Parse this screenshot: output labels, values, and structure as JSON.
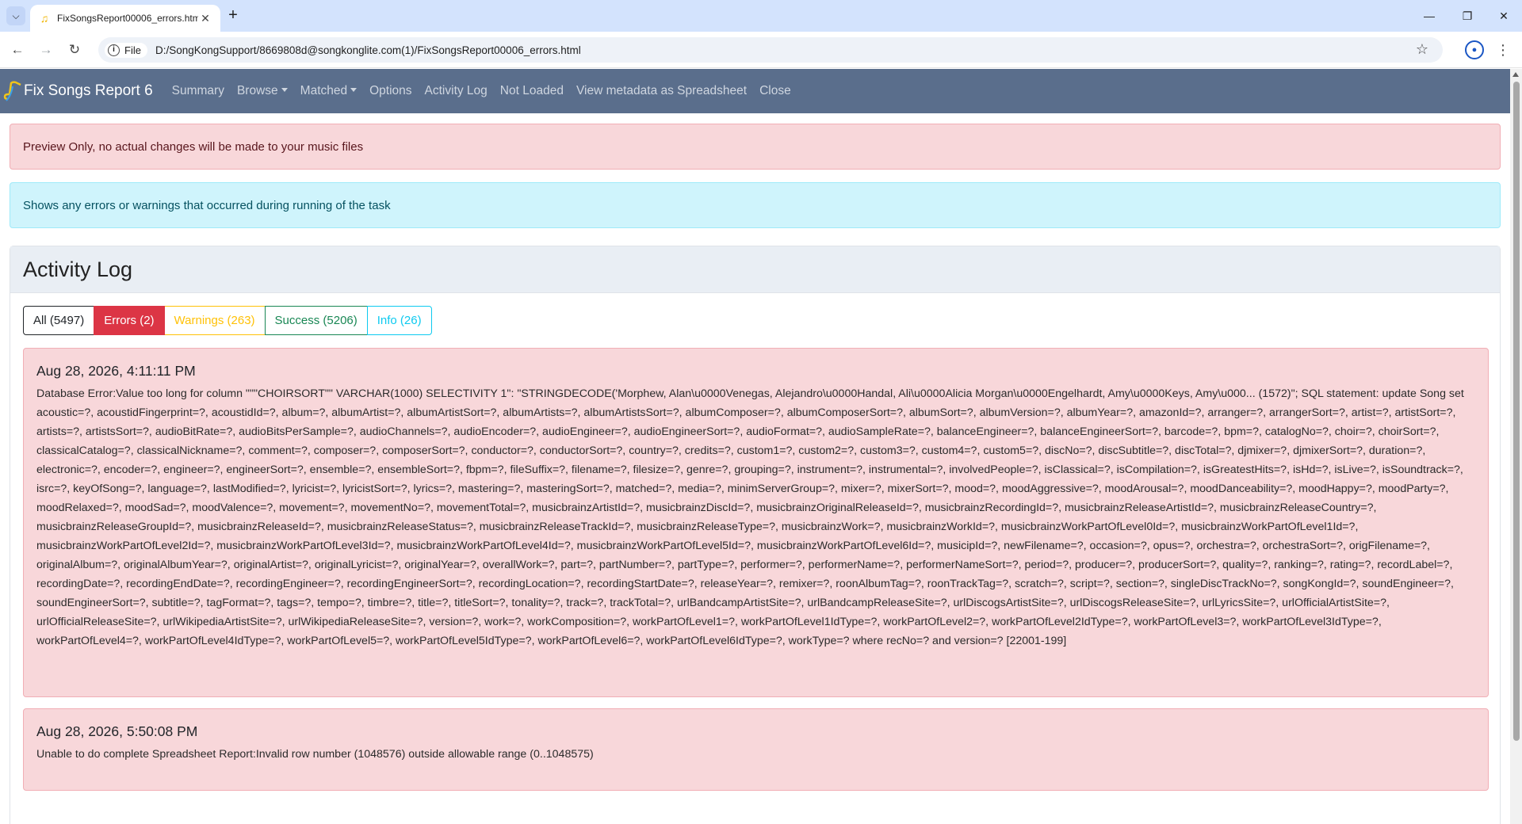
{
  "browser": {
    "tab_title": "FixSongsReport00006_errors.html",
    "file_chip": "File",
    "url": "D:/SongKongSupport/8669808d@songkonglite.com(1)/FixSongsReport00006_errors.html"
  },
  "navbar": {
    "brand": "Fix Songs Report 6",
    "links": [
      "Summary",
      "Browse",
      "Matched",
      "Options",
      "Activity Log",
      "Not Loaded",
      "View metadata as Spreadsheet",
      "Close"
    ]
  },
  "alerts": {
    "preview": "Preview Only, no actual changes will be made to your music files",
    "info": "Shows any errors or warnings that occurred during running of the task"
  },
  "activity": {
    "title": "Activity Log",
    "filters": [
      "All (5497)",
      "Errors (2)",
      "Warnings (263)",
      "Success (5206)",
      "Info (26)"
    ],
    "selected_filter": "Errors (2)",
    "entries": [
      {
        "timestamp": "Aug 28, 2026, 4:11:11 PM",
        "message": "Database Error:Value too long for column \"\"\"CHOIRSORT\"\" VARCHAR(1000) SELECTIVITY 1\": \"STRINGDECODE('Morphew, Alan\\u0000Venegas, Alejandro\\u0000Handal, Ali\\u0000Alicia Morgan\\u0000Engelhardt, Amy\\u0000Keys, Amy\\u000... (1572)\"; SQL statement: update Song set acoustic=?, acoustidFingerprint=?, acoustidId=?, album=?, albumArtist=?, albumArtistSort=?, albumArtists=?, albumArtistsSort=?, albumComposer=?, albumComposerSort=?, albumSort=?, albumVersion=?, albumYear=?, amazonId=?, arranger=?, arrangerSort=?, artist=?, artistSort=?, artists=?, artistsSort=?, audioBitRate=?, audioBitsPerSample=?, audioChannels=?, audioEncoder=?, audioEngineer=?, audioEngineerSort=?, audioFormat=?, audioSampleRate=?, balanceEngineer=?, balanceEngineerSort=?, barcode=?, bpm=?, catalogNo=?, choir=?, choirSort=?, classicalCatalog=?, classicalNickname=?, comment=?, composer=?, composerSort=?, conductor=?, conductorSort=?, country=?, credits=?, custom1=?, custom2=?, custom3=?, custom4=?, custom5=?, discNo=?, discSubtitle=?, discTotal=?, djmixer=?, djmixerSort=?, duration=?, electronic=?, encoder=?, engineer=?, engineerSort=?, ensemble=?, ensembleSort=?, fbpm=?, fileSuffix=?, filename=?, filesize=?, genre=?, grouping=?, instrument=?, instrumental=?, involvedPeople=?, isClassical=?, isCompilation=?, isGreatestHits=?, isHd=?, isLive=?, isSoundtrack=?, isrc=?, keyOfSong=?, language=?, lastModified=?, lyricist=?, lyricistSort=?, lyrics=?, mastering=?, masteringSort=?, matched=?, media=?, minimServerGroup=?, mixer=?, mixerSort=?, mood=?, moodAggressive=?, moodArousal=?, moodDanceability=?, moodHappy=?, moodParty=?, moodRelaxed=?, moodSad=?, moodValence=?, movement=?, movementNo=?, movementTotal=?, musicbrainzArtistId=?, musicbrainzDiscId=?, musicbrainzOriginalReleaseId=?, musicbrainzRecordingId=?, musicbrainzReleaseArtistId=?, musicbrainzReleaseCountry=?, musicbrainzReleaseGroupId=?, musicbrainzReleaseId=?, musicbrainzReleaseStatus=?, musicbrainzReleaseTrackId=?, musicbrainzReleaseType=?, musicbrainzWork=?, musicbrainzWorkId=?, musicbrainzWorkPartOfLevel0Id=?, musicbrainzWorkPartOfLevel1Id=?, musicbrainzWorkPartOfLevel2Id=?, musicbrainzWorkPartOfLevel3Id=?, musicbrainzWorkPartOfLevel4Id=?, musicbrainzWorkPartOfLevel5Id=?, musicbrainzWorkPartOfLevel6Id=?, musicipId=?, newFilename=?, occasion=?, opus=?, orchestra=?, orchestraSort=?, origFilename=?, originalAlbum=?, originalAlbumYear=?, originalArtist=?, originalLyricist=?, originalYear=?, overallWork=?, part=?, partNumber=?, partType=?, performer=?, performerName=?, performerNameSort=?, period=?, producer=?, producerSort=?, quality=?, ranking=?, rating=?, recordLabel=?, recordingDate=?, recordingEndDate=?, recordingEngineer=?, recordingEngineerSort=?, recordingLocation=?, recordingStartDate=?, releaseYear=?, remixer=?, roonAlbumTag=?, roonTrackTag=?, scratch=?, script=?, section=?, singleDiscTrackNo=?, songKongId=?, soundEngineer=?, soundEngineerSort=?, subtitle=?, tagFormat=?, tags=?, tempo=?, timbre=?, title=?, titleSort=?, tonality=?, track=?, trackTotal=?, urlBandcampArtistSite=?, urlBandcampReleaseSite=?, urlDiscogsArtistSite=?, urlDiscogsReleaseSite=?, urlLyricsSite=?, urlOfficialArtistSite=?, urlOfficialReleaseSite=?, urlWikipediaArtistSite=?, urlWikipediaReleaseSite=?, version=?, work=?, workComposition=?, workPartOfLevel1=?, workPartOfLevel1IdType=?, workPartOfLevel2=?, workPartOfLevel2IdType=?, workPartOfLevel3=?, workPartOfLevel3IdType=?, workPartOfLevel4=?, workPartOfLevel4IdType=?, workPartOfLevel5=?, workPartOfLevel5IdType=?, workPartOfLevel6=?, workPartOfLevel6IdType=?, workType=? where recNo=? and version=? [22001-199]"
      },
      {
        "timestamp": "Aug 28, 2026, 5:50:08 PM",
        "message": "Unable to do complete Spreadsheet Report:Invalid row number (1048576) outside allowable range (0..1048575)"
      }
    ]
  },
  "colors": {
    "navbar_bg": "#5a6e8c",
    "danger_bg": "#f8d7da",
    "info_bg": "#cff4fc",
    "error_btn": "#dc3545",
    "warning_btn": "#ffc107",
    "success_btn": "#198754",
    "info_btn": "#0dcaf0"
  }
}
